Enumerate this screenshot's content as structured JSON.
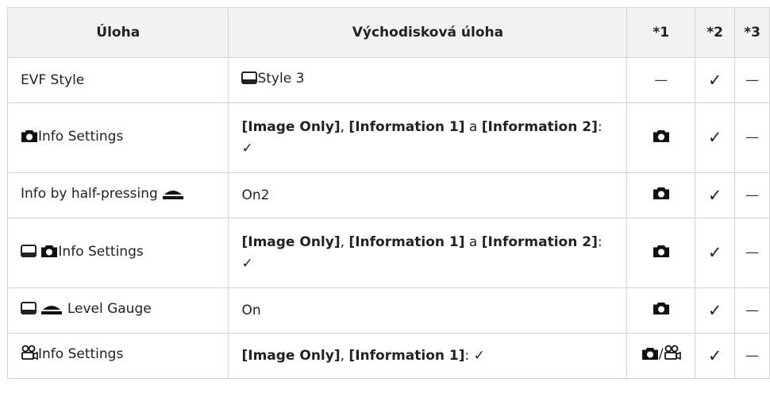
{
  "header": {
    "col1": "Úloha",
    "col2": "Východisková úloha",
    "col3": "*1",
    "col4": "*2",
    "col5": "*3"
  },
  "rows": [
    {
      "label": "EVF Style",
      "value": "Style 3",
      "c1": "—",
      "c2": "✓",
      "c3": "—"
    },
    {
      "label": "Info Settings",
      "opt1": "[Image Only]",
      "sep1": ", ",
      "opt2": "[Information 1]",
      "sep2": " a ",
      "opt3": "[Information 2]",
      "tail": ": ✓",
      "c2": "✓",
      "c3": "—"
    },
    {
      "label": "Info by half-pressing",
      "value": "On2",
      "c2": "✓",
      "c3": "—"
    },
    {
      "label": "Info Settings",
      "opt1": "[Image Only]",
      "sep1": ", ",
      "opt2": "[Information 1]",
      "sep2": " a ",
      "opt3": "[Information 2]",
      "tail": ": ✓",
      "c2": "✓",
      "c3": "—"
    },
    {
      "label": "Level Gauge",
      "value": "On",
      "c2": "✓",
      "c3": "—"
    },
    {
      "label": "Info Settings",
      "opt1": "[Image Only]",
      "sep1": ", ",
      "opt2": "[Information 1]",
      "tail": ": ✓",
      "c1sep": "/",
      "c2": "✓",
      "c3": "—"
    }
  ]
}
